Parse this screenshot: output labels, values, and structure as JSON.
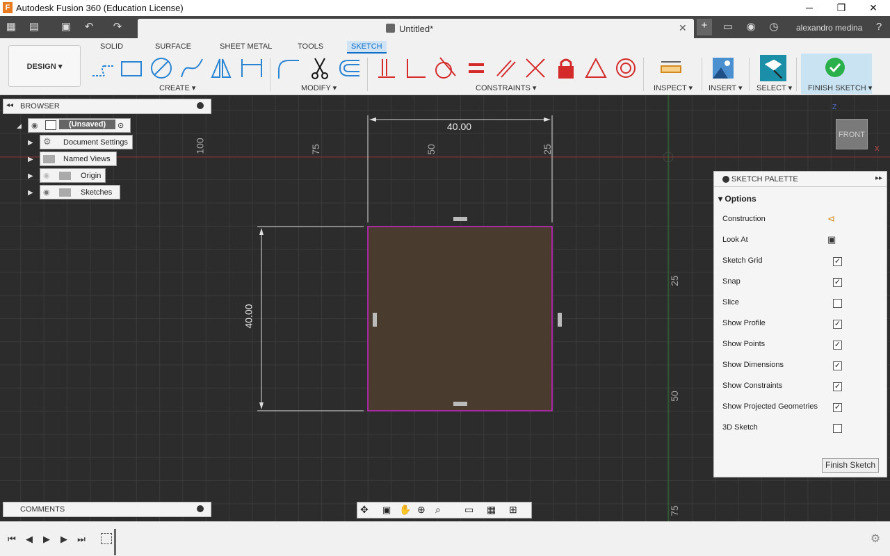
{
  "window": {
    "title": "Autodesk Fusion 360 (Education License)",
    "app_icon": "F",
    "minimize": "─",
    "maximize": "❐",
    "close": "✕"
  },
  "tabbar": {
    "doc_title": "Untitled*",
    "user": "alexandro medina"
  },
  "toolbar": {
    "design_label": "DESIGN ▾",
    "tabs": [
      "SOLID",
      "SURFACE",
      "SHEET METAL",
      "TOOLS",
      "SKETCH"
    ],
    "groups": {
      "create": "CREATE ▾",
      "modify": "MODIFY ▾",
      "constraints": "CONSTRAINTS ▾",
      "inspect": "INSPECT ▾",
      "insert": "INSERT ▾",
      "select": "SELECT ▾",
      "finish": "FINISH SKETCH ▾"
    }
  },
  "browser": {
    "title": "BROWSER",
    "root": "(Unsaved)",
    "items": [
      "Document Settings",
      "Named Views",
      "Origin",
      "Sketches"
    ]
  },
  "comments": {
    "title": "COMMENTS"
  },
  "sketch": {
    "dim_horizontal": "40.00",
    "dim_vertical": "40.00",
    "profile_color": "#4a3b2f",
    "line_color": "#cc22cc"
  },
  "axes": {
    "top_labels": [
      "100",
      "75",
      "50",
      "25"
    ],
    "right_labels": [
      "25",
      "50",
      "75"
    ]
  },
  "viewcube": {
    "face": "FRONT",
    "z": "Z",
    "x": "X"
  },
  "palette": {
    "title": "SKETCH PALETTE",
    "section": "Options",
    "rows": [
      {
        "label": "Construction",
        "type": "icon"
      },
      {
        "label": "Look At",
        "type": "icon"
      },
      {
        "label": "Sketch Grid",
        "type": "check",
        "checked": true
      },
      {
        "label": "Snap",
        "type": "check",
        "checked": true
      },
      {
        "label": "Slice",
        "type": "check",
        "checked": false
      },
      {
        "label": "Show Profile",
        "type": "check",
        "checked": true
      },
      {
        "label": "Show Points",
        "type": "check",
        "checked": true
      },
      {
        "label": "Show Dimensions",
        "type": "check",
        "checked": true
      },
      {
        "label": "Show Constraints",
        "type": "check",
        "checked": true
      },
      {
        "label": "Show Projected Geometries",
        "type": "check",
        "checked": true
      },
      {
        "label": "3D Sketch",
        "type": "check",
        "checked": false
      }
    ],
    "finish_label": "Finish Sketch"
  }
}
